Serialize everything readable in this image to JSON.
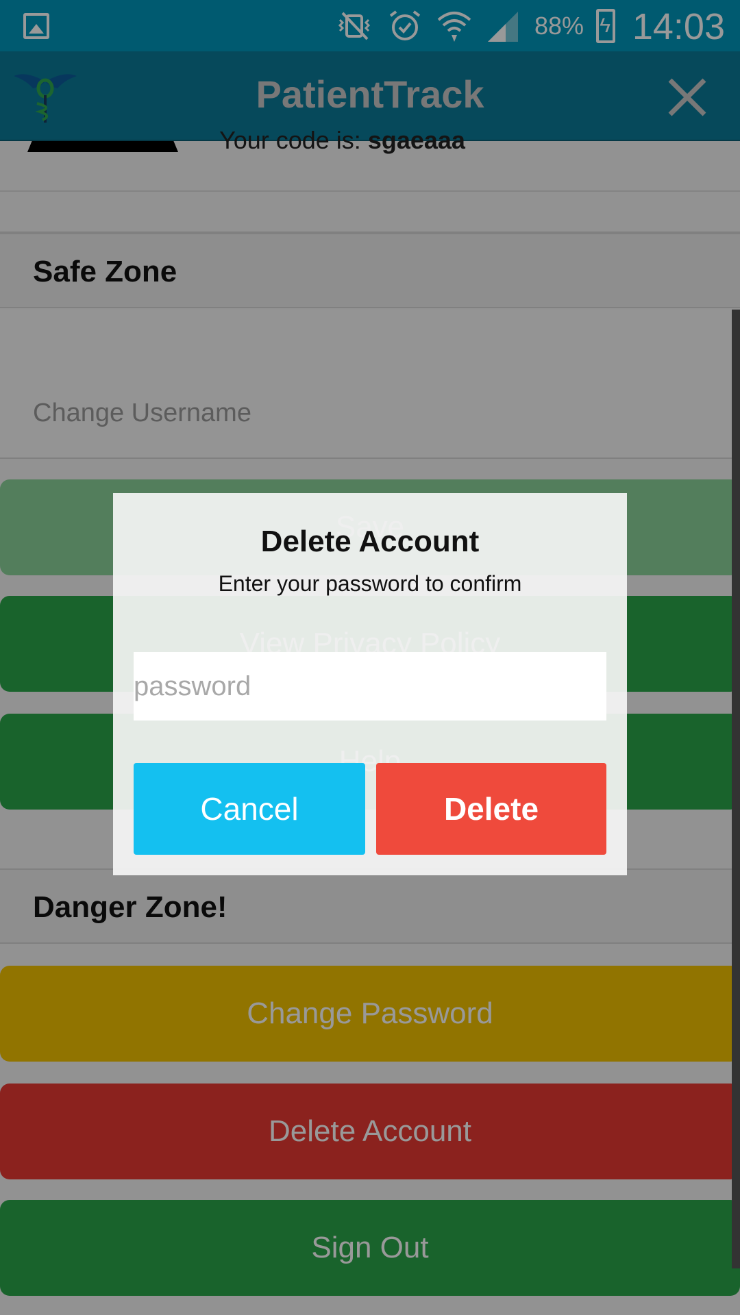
{
  "status_bar": {
    "battery": "88%",
    "time": "14:03",
    "icons": [
      "gallery-icon",
      "vibrate-mute-icon",
      "alarm-icon",
      "wifi-icon",
      "signal-icon",
      "battery-charging-icon"
    ]
  },
  "app_bar": {
    "title": "PatientTrack",
    "logo_icon": "caduceus-logo-icon",
    "close_icon": "close-icon"
  },
  "profile": {
    "code_prefix": "Your code is: ",
    "code_value": "sgaeaaa"
  },
  "safe_zone": {
    "heading": "Safe Zone",
    "username_placeholder": "Change Username",
    "save_label": "Save",
    "privacy_label": "View Privacy Policy",
    "help_label": "Help"
  },
  "danger_zone": {
    "heading": "Danger Zone!",
    "change_password_label": "Change Password",
    "delete_account_label": "Delete Account",
    "sign_out_label": "Sign Out"
  },
  "dialog": {
    "title": "Delete Account",
    "subtitle": "Enter your password to confirm",
    "password_placeholder": "password",
    "cancel_label": "Cancel",
    "delete_label": "Delete"
  },
  "colors": {
    "status_bar": "#0097bb",
    "app_bar": "#0a7a98",
    "green": "#2aa54a",
    "yellow": "#f2c200",
    "red": "#e83a32",
    "cancel_blue": "#14c0f0",
    "delete_red": "#ef4a3c"
  }
}
